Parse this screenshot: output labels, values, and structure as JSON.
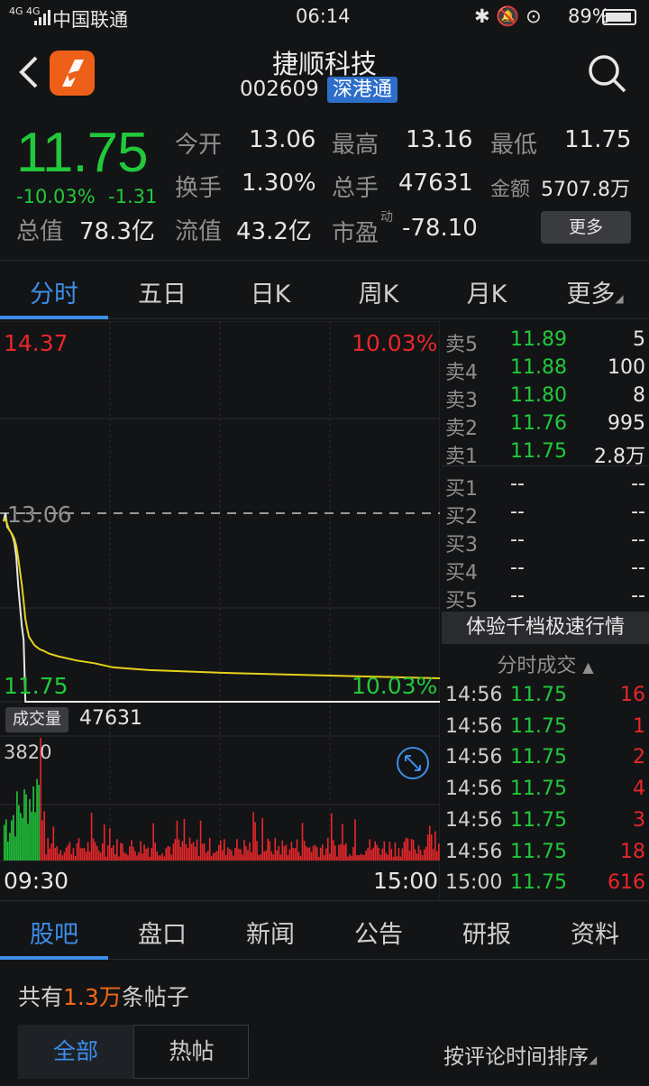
{
  "status": {
    "network": "4G 4G",
    "carrier": "中国联通",
    "time": "06:14",
    "battery": "89%"
  },
  "header": {
    "name": "捷顺科技",
    "code": "002609",
    "badge": "深港通",
    "back_icon": "back-arrow-icon",
    "search_icon": "search-icon"
  },
  "quote": {
    "price": "11.75",
    "change_pct": "-10.03%",
    "change": "-1.31",
    "open_label": "今开",
    "open": "13.06",
    "high_label": "最高",
    "high": "13.16",
    "low_label": "最低",
    "low": "11.75",
    "turnover_label": "换手",
    "turnover": "1.30%",
    "volume_label": "总手",
    "volume": "47631",
    "amount_label": "金额",
    "amount": "5707.8万",
    "mcap_label": "总值",
    "mcap": "78.3亿",
    "float_label": "流值",
    "float": "43.2亿",
    "pe_label": "市盈",
    "pe_sup": "动",
    "pe": "-78.10",
    "more": "更多"
  },
  "tabs": [
    "分时",
    "五日",
    "日K",
    "周K",
    "月K",
    "更多"
  ],
  "chart": {
    "top_price": "14.37",
    "top_pct": "10.03%",
    "prev_close": "13.06",
    "bottom_price": "11.75",
    "bottom_pct": "10.03%",
    "volume_label": "成交量",
    "volume": "47631",
    "vol_max": "3820",
    "time_start": "09:30",
    "time_end": "15:00"
  },
  "chart_data": {
    "type": "line",
    "title": "",
    "ylim": [
      11.75,
      14.37
    ],
    "x": [
      0,
      1,
      2,
      3,
      4,
      5,
      6,
      7,
      8,
      9,
      10,
      11,
      12,
      13,
      14,
      15,
      16,
      17,
      18,
      20,
      22,
      25,
      30,
      40,
      50,
      60,
      70,
      80,
      100,
      120,
      150,
      180,
      210,
      240
    ],
    "series": [
      {
        "values": [
          13.06,
          13.12,
          13.02,
          13.0,
          12.98,
          12.95,
          12.9,
          12.8,
          12.6,
          12.45,
          12.3,
          12.2,
          11.75,
          11.75,
          11.75,
          11.75,
          11.75,
          11.75,
          11.75,
          11.75,
          11.75,
          11.75,
          11.75,
          11.75,
          11.75,
          11.75,
          11.75,
          11.75,
          11.75,
          11.75,
          11.75,
          11.75,
          11.75,
          11.75
        ]
      },
      {
        "values": [
          13.06,
          13.08,
          13.04,
          13.0,
          12.98,
          12.96,
          12.93,
          12.88,
          12.8,
          12.7,
          12.6,
          12.48,
          12.35,
          12.28,
          12.22,
          12.2,
          12.18,
          12.16,
          12.15,
          12.13,
          12.12,
          12.1,
          12.08,
          12.05,
          12.03,
          12.0,
          11.99,
          11.98,
          11.97,
          11.96,
          11.95,
          11.94,
          11.93,
          11.92
        ]
      }
    ]
  },
  "orderbook": {
    "asks": [
      {
        "label": "卖5",
        "price": "11.89",
        "vol": "5"
      },
      {
        "label": "卖4",
        "price": "11.88",
        "vol": "100"
      },
      {
        "label": "卖3",
        "price": "11.80",
        "vol": "8"
      },
      {
        "label": "卖2",
        "price": "11.76",
        "vol": "995"
      },
      {
        "label": "卖1",
        "price": "11.75",
        "vol": "2.8万"
      }
    ],
    "bids": [
      {
        "label": "买1",
        "price": "--",
        "vol": "--"
      },
      {
        "label": "买2",
        "price": "--",
        "vol": "--"
      },
      {
        "label": "买3",
        "price": "--",
        "vol": "--"
      },
      {
        "label": "买4",
        "price": "--",
        "vol": "--"
      },
      {
        "label": "买5",
        "price": "--",
        "vol": "--"
      }
    ],
    "promo": "体验千档极速行情",
    "ticks_title": "分时成交",
    "ticks": [
      {
        "time": "14:56",
        "price": "11.75",
        "vol": "16"
      },
      {
        "time": "14:56",
        "price": "11.75",
        "vol": "1"
      },
      {
        "time": "14:56",
        "price": "11.75",
        "vol": "2"
      },
      {
        "time": "14:56",
        "price": "11.75",
        "vol": "4"
      },
      {
        "time": "14:56",
        "price": "11.75",
        "vol": "3"
      },
      {
        "time": "14:56",
        "price": "11.75",
        "vol": "18"
      },
      {
        "time": "15:00",
        "price": "11.75",
        "vol": "616"
      }
    ]
  },
  "bottom_tabs": [
    "股吧",
    "盘口",
    "新闻",
    "公告",
    "研报",
    "资料"
  ],
  "forum": {
    "posts_prefix": "共有",
    "posts_count": "1.3万",
    "posts_suffix": "条帖子",
    "filter_all": "全部",
    "filter_hot": "热帖",
    "sort": "按评论时间排序"
  },
  "colors": {
    "up": "#e8272a",
    "down": "#21c93a",
    "accent": "#3c8ee8",
    "avg_line": "#e6d21a"
  }
}
